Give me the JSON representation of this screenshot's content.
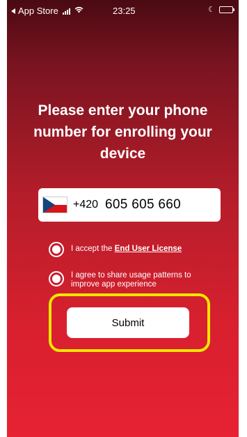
{
  "status_bar": {
    "back_label": "App Store",
    "time": "23:25",
    "moon_icon": "moon-icon",
    "battery_color": "#4cd964"
  },
  "title": "Please enter your phone number for enrolling your device",
  "phone": {
    "flag_icon": "czech-flag-icon",
    "country_code": "+420",
    "number": "605 605 660"
  },
  "checkboxes": [
    {
      "text": "I accept the ",
      "link": "End User License",
      "checked": true
    },
    {
      "text": "I agree to share usage patterns to improve app experience",
      "checked": true
    }
  ],
  "submit": {
    "label": "Submit",
    "highlight_color": "#f2e600"
  },
  "colors": {
    "gradient_top": "#4a0a12",
    "gradient_bottom": "#e62233"
  }
}
